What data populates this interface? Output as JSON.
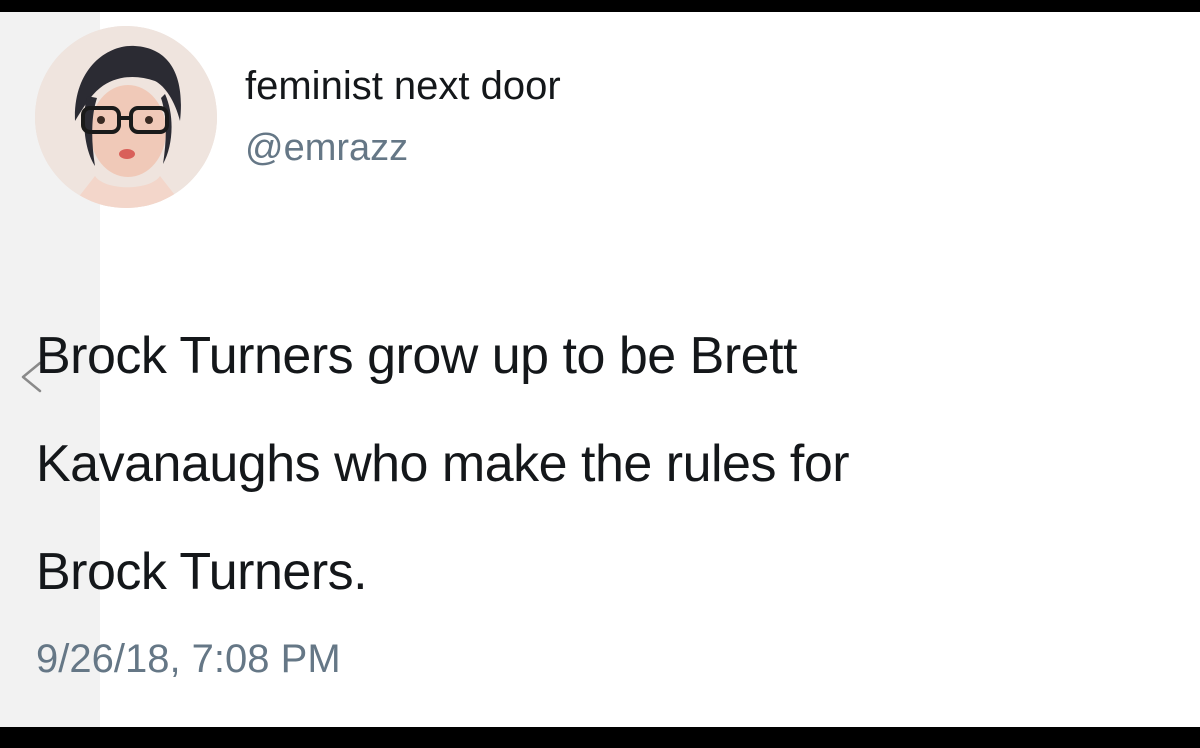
{
  "tweet": {
    "display_name": "feminist next door",
    "handle": "@emrazz",
    "text_lines": [
      "Brock Turners grow up to be Brett",
      "Kavanaughs who make the rules for",
      "Brock Turners."
    ],
    "timestamp": "9/26/18, 7:08 PM"
  },
  "icons": {
    "back": "chevron-left-icon",
    "avatar": "profile-photo"
  },
  "colors": {
    "text": "#14171a",
    "secondary_text": "#657786",
    "background": "#ffffff",
    "frame": "#000000"
  }
}
